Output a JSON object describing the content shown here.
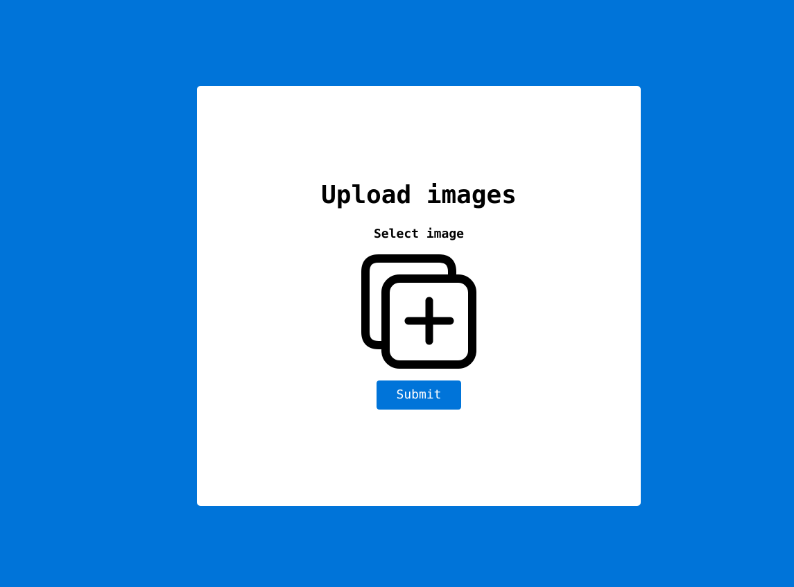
{
  "colors": {
    "background": "#0074d9",
    "card": "#ffffff",
    "accent": "#0074d9",
    "text": "#000000"
  },
  "upload": {
    "title": "Upload images",
    "select_label": "Select image",
    "icon": "add-image-icon",
    "submit_label": "Submit"
  }
}
